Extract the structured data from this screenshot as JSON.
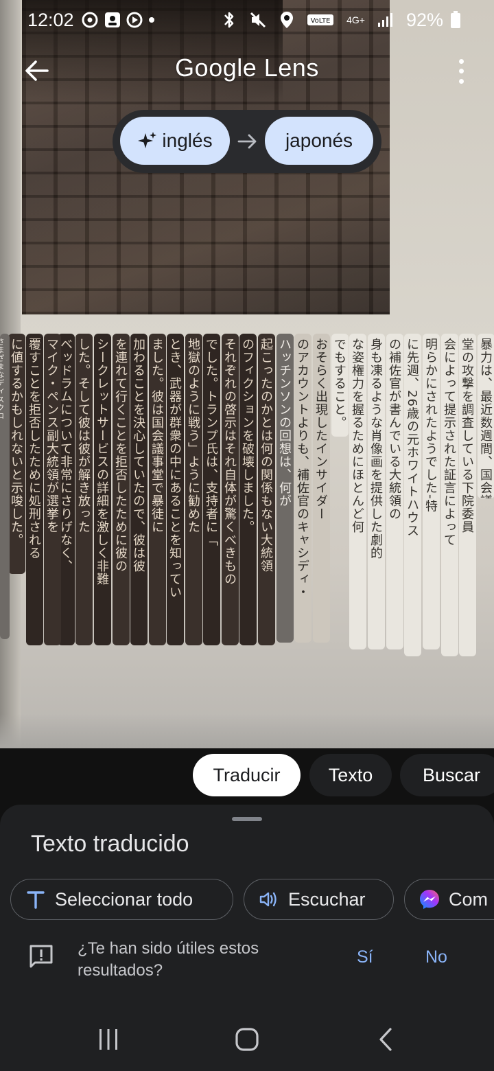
{
  "status_bar": {
    "time": "12:02",
    "battery": "92%",
    "network": "4G+",
    "volte": "VoLTE"
  },
  "app_bar": {
    "title": "Google Lens"
  },
  "language": {
    "source": "inglés",
    "target": "japonés"
  },
  "translated_columns": [
    "暴力は、最近数週間、国会議事",
    "堂の攻撃を調査している下院委員",
    "会によって提示された証言によって",
    "明らかにされたようでした-特",
    "に先週、26歳の元ホワイトハウス",
    "の補佐官が書んでいる大統領の",
    "身も凍るような肖像画を提供した劇的",
    "な姿権力を握るためにほとんど何",
    "でもすること。",
    "おそらく出現したインサイダー",
    "のアカウントよりも、補佐官のキャシディ・",
    "ハッチンソンの回想は、何が",
    "起こったのかとは何の関係もない大統領",
    "のフィクションを破壊しました。",
    "それぞれの啓示はそれ自体が驚くべきもの",
    "でした。トランプ氏は、支持者に「",
    "地獄のように戦う」ように勧めた",
    "とき、武器が群衆の中にあることを知ってい",
    "ました。彼は国会議事堂で暴徒に",
    "加わることを決心していたので、彼は彼",
    "を連れて行くことを拒否したために彼の",
    "シークレットサービスの詳細を激しく非難",
    "した。そして彼は彼が解き放った",
    "ベッドラムについて非常にさりげなく、",
    "マイク・ペンス副大統領が選挙を",
    "覆すことを拒否したために処刑される",
    "に値するかもしれないと示唆した。",
    "さまざまなディスクロ"
  ],
  "mode_tabs": {
    "translate": "Traducir",
    "text": "Texto",
    "search": "Buscar"
  },
  "bottom_sheet": {
    "title": "Texto traducido",
    "actions": {
      "select_all": "Seleccionar todo",
      "listen": "Escuchar",
      "share": "Com"
    },
    "feedback": {
      "question": "¿Te han sido útiles estos resultados?",
      "yes": "Sí",
      "no": "No"
    }
  },
  "colors": {
    "chip_blue": "#d3e3fd",
    "sheet_bg": "#1f2022",
    "link_blue": "#8ab4f8"
  },
  "icons": [
    "back-arrow-icon",
    "overflow-menu-icon",
    "sparkle-icon",
    "arrow-right-icon",
    "text-t-icon",
    "speaker-icon",
    "messenger-icon",
    "feedback-icon",
    "recents-icon",
    "home-icon",
    "nav-back-icon"
  ]
}
